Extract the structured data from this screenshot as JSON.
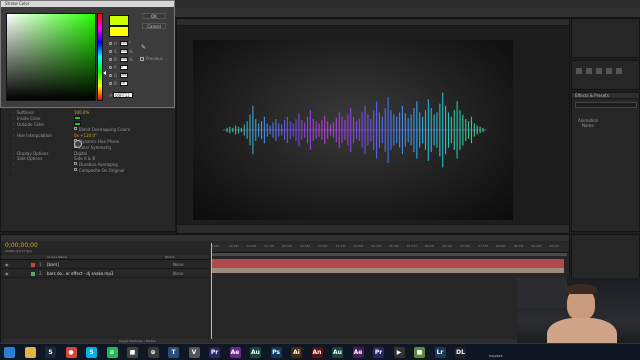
{
  "app": {
    "frame_title": "",
    "composition_label": ""
  },
  "color_dialog": {
    "title": "Stroke Color",
    "ok_label": "OK",
    "cancel_label": "Cancel",
    "previous_label": "Previous",
    "hex_label": "#",
    "hex_value": "00FF12",
    "colors": {
      "new": "#ccff00",
      "old": "#ffff00",
      "selected": "#33e61a"
    },
    "fields": [
      {
        "label": "H",
        "value": "127",
        "unit": "°"
      },
      {
        "label": "S",
        "value": "100",
        "unit": "%"
      },
      {
        "label": "B",
        "value": "100",
        "unit": "%"
      },
      {
        "label": "R",
        "value": "0",
        "unit": ""
      },
      {
        "label": "G",
        "value": "255",
        "unit": ""
      },
      {
        "label": "B",
        "value": "18",
        "unit": ""
      }
    ]
  },
  "effects_panel": {
    "rows": [
      {
        "label": "Softness",
        "value": "100.0%",
        "value_color": "orange"
      },
      {
        "label": "Inside Color",
        "swatch": "#23c12c"
      },
      {
        "label": "Outside Color",
        "swatch": "#23c12c"
      },
      {
        "label": "",
        "value": "Blend Overlapping Colors",
        "check": true
      },
      {
        "label": "Hue Interpolation",
        "value": "0x +120.0°",
        "value_color": "orange"
      },
      {
        "label": "",
        "value": "Dynamic Hue Phase",
        "check": true
      },
      {
        "label": "",
        "value": "Color Symmetry",
        "check": true
      },
      {
        "label": "Display Options",
        "value": "Digital"
      },
      {
        "label": "Side Options",
        "value": "Side A & B"
      },
      {
        "label": "",
        "value": "Duration Averaging",
        "check": true
      },
      {
        "label": "",
        "value": "Composite On Original",
        "check": true
      }
    ]
  },
  "viewer": {
    "waveform": {
      "amplitudes": [
        2,
        3,
        2,
        4,
        3,
        2,
        5,
        8,
        14,
        22,
        10,
        6,
        8,
        12,
        6,
        4,
        7,
        10,
        6,
        5,
        9,
        12,
        8,
        6,
        10,
        15,
        9,
        7,
        12,
        18,
        10,
        8,
        6,
        9,
        13,
        8,
        5,
        7,
        11,
        16,
        12,
        9,
        14,
        20,
        12,
        8,
        10,
        16,
        22,
        14,
        10,
        18,
        26,
        16,
        12,
        20,
        30,
        18,
        14,
        12,
        16,
        22,
        15,
        11,
        14,
        20,
        26,
        16,
        12,
        18,
        28,
        20,
        14,
        16,
        24,
        34,
        22,
        16,
        12,
        18,
        26,
        18,
        14,
        10,
        8,
        12,
        6,
        4,
        3,
        2
      ],
      "colors": [
        "#2ecc71",
        "#3b9fe0",
        "#6a4ae8",
        "#b73fd6",
        "#8a3ee0",
        "#4a6ff0",
        "#2fa6e8",
        "#27c7b8",
        "#3ecf72"
      ]
    }
  },
  "right_panels": {
    "effects_presets": {
      "title": "Effects & Presets",
      "items": [
        "Animation",
        "Name"
      ]
    }
  },
  "timeline": {
    "timecode": "0;00;00;00",
    "timecode_sub": "00000 (29.97 fps)",
    "column_source": "Source Name",
    "column_parent": "Parent",
    "layers": [
      {
        "num": "1",
        "name": "[bars]",
        "parent": "None",
        "color": "#c8464a"
      },
      {
        "num": "2",
        "name": "bars do...er effect - dj snake.mp3",
        "parent": "None",
        "color": "#5fa868"
      }
    ],
    "ruler_ticks": [
      "0:00f",
      "00:15f",
      "01:00f",
      "01:15f",
      "02:00f",
      "02:15f",
      "03:00f",
      "03:15f",
      "04:00f",
      "04:15f",
      "05:00f",
      "05:15f",
      "06:00f",
      "06:15f",
      "07:00f",
      "07:15f",
      "08:00f",
      "08:15f",
      "09:00f",
      "09:15f"
    ],
    "status": "Toggle Switches / Modes"
  },
  "taskbar": {
    "apps": [
      {
        "icon": "start-icon",
        "color": "#2a7fd4",
        "glyph": ""
      },
      {
        "icon": "folder-icon",
        "color": "#e0b640",
        "glyph": ""
      },
      {
        "icon": "steam-icon",
        "color": "#1b2838",
        "glyph": "S"
      },
      {
        "icon": "chrome-icon",
        "color": "#d64535",
        "glyph": "●"
      },
      {
        "icon": "skype-icon",
        "color": "#00aff0",
        "glyph": "S"
      },
      {
        "icon": "spotify-icon",
        "color": "#1db954",
        "glyph": "≡"
      },
      {
        "icon": "app-icon",
        "color": "#444",
        "glyph": "■"
      },
      {
        "icon": "app-icon-2",
        "color": "#3a3a3a",
        "glyph": "⊕"
      },
      {
        "icon": "teamspeak-icon",
        "color": "#2b4d7a",
        "glyph": "T"
      },
      {
        "icon": "vegas-icon",
        "color": "#555",
        "glyph": "V"
      },
      {
        "icon": "premiere-icon",
        "color": "#2a2566",
        "glyph": "Pr"
      },
      {
        "icon": "aftereffects-icon",
        "color": "#6b2a8a",
        "glyph": "Ae"
      },
      {
        "icon": "audition-icon",
        "color": "#13493c",
        "glyph": "Au"
      },
      {
        "icon": "photoshop-icon",
        "color": "#0c3a5e",
        "glyph": "Ps"
      },
      {
        "icon": "illustrator-icon",
        "color": "#4a2a08",
        "glyph": "Ai"
      },
      {
        "icon": "animate-icon",
        "color": "#5a1212",
        "glyph": "An"
      },
      {
        "icon": "audition-icon-2",
        "color": "#14483a",
        "glyph": "Au"
      },
      {
        "icon": "after-effects-icon-2",
        "color": "#4a1a5a",
        "glyph": "Ae"
      },
      {
        "icon": "premiere-icon-2",
        "color": "#2a2566",
        "glyph": "Pr"
      },
      {
        "icon": "player-icon",
        "color": "#333",
        "glyph": "▶"
      },
      {
        "icon": "minecraft-icon",
        "color": "#5a8a3a",
        "glyph": "■"
      },
      {
        "icon": "lightroom-icon",
        "color": "#1a3a5a",
        "glyph": "Lr"
      },
      {
        "icon": "dl-icon",
        "color": "#222",
        "glyph": "DL"
      }
    ],
    "clock_time": "",
    "clock_date": "5/2/2015"
  }
}
